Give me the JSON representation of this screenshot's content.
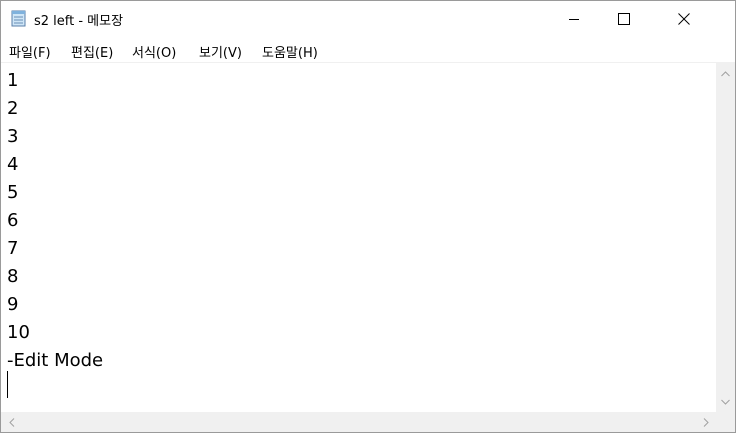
{
  "window": {
    "title": "s2 left - 메모장",
    "icon": "notepad-icon"
  },
  "caption_buttons": {
    "minimize_icon": "minimize-icon",
    "maximize_icon": "maximize-icon",
    "close_icon": "close-icon"
  },
  "menu": {
    "items": [
      {
        "label": "파일(F)"
      },
      {
        "label": "편집(E)"
      },
      {
        "label": "서식(O)"
      },
      {
        "label": "보기(V)"
      },
      {
        "label": "도움말(H)"
      }
    ]
  },
  "editor": {
    "lines": [
      "1",
      "2",
      "3",
      "4",
      "5",
      "6",
      "7",
      "8",
      "9",
      "10",
      "-Edit Mode"
    ]
  },
  "scrollbars": {
    "up_icon": "chevron-up-icon",
    "down_icon": "chevron-down-icon",
    "left_icon": "chevron-left-icon",
    "right_icon": "chevron-right-icon"
  },
  "colors": {
    "scrollbar_track": "#f0f0f0",
    "arrow": "#a0a0a0",
    "text": "#000000"
  }
}
